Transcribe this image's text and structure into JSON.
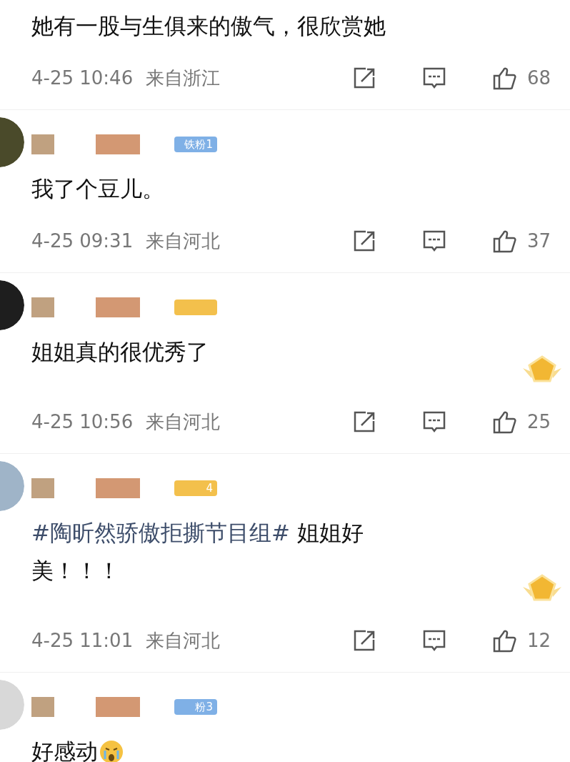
{
  "comments": [
    {
      "body": [
        {
          "text": "她有一股与生俱来的傲气，很欣赏她"
        }
      ],
      "time": "4-25 10:46",
      "location": "来自浙江",
      "likes": "68"
    },
    {
      "color": "#4a4a2a",
      "badge": {
        "text": "铁粉1",
        "color": "#7fb0e6"
      },
      "body": [
        {
          "text": "我了个豆儿。"
        }
      ],
      "time": "4-25 09:31",
      "location": "来自河北",
      "likes": "37"
    },
    {
      "color": "#1e1e1e",
      "badge": {
        "color": "#f3c04c"
      },
      "medal": true,
      "body": [
        {
          "text": "姐姐真的很优秀了"
        }
      ],
      "time": "4-25 10:56",
      "location": "来自河北",
      "likes": "25"
    },
    {
      "color": "#9fb4c8",
      "badge": {
        "text": "4",
        "color": "#f3c04c"
      },
      "medal": true,
      "body": [
        {
          "topic": "#陶昕然骄傲拒撕节目组#",
          "text": "姐姐好"
        },
        {
          "text": "美！！！"
        }
      ],
      "time": "4-25 11:01",
      "location": "来自河北",
      "likes": "12"
    },
    {
      "color": "#d8d8d8",
      "badge": {
        "text": "粉3",
        "color": "#7fb0e6"
      },
      "emoji": true,
      "body": [
        {
          "text": "好感动"
        }
      ]
    }
  ]
}
